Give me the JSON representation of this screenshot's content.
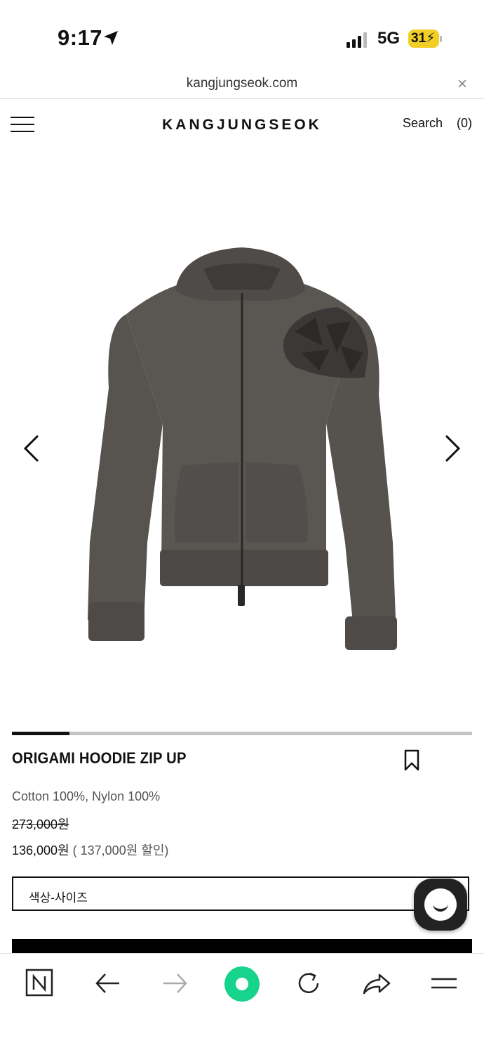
{
  "status_bar": {
    "time": "9:17",
    "network": "5G",
    "battery": "31"
  },
  "browser": {
    "url": "kangjungseok.com",
    "close_symbol": "×"
  },
  "site_header": {
    "logo": "KANGJUNGSEOK",
    "search_label": "Search",
    "cart_label": "(0)"
  },
  "gallery": {
    "slide_progress": 0.125,
    "image_label": "Dark grey zip-up hoodie with origami shoulder detail"
  },
  "product": {
    "name": "ORIGAMI HOODIE ZIP UP",
    "material": "Cotton 100%, Nylon 100%",
    "original_price": "273,000원",
    "sale_price": "136,000원",
    "discount_note": " ( 137,000원 할인)",
    "option_label": "색상-사이즈"
  },
  "colors": {
    "accent_green": "#17d38b",
    "battery_yellow": "#f2cf27"
  }
}
